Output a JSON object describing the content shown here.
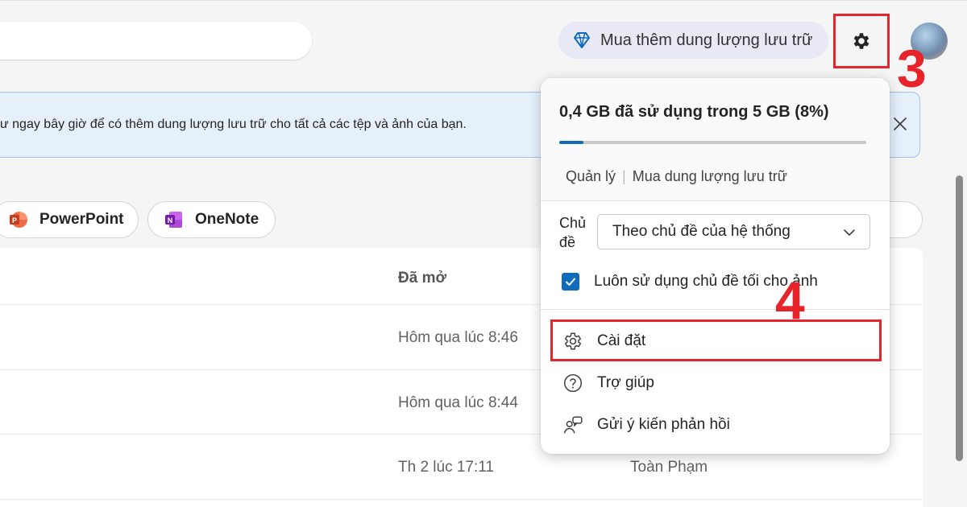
{
  "header": {
    "storage_button_label": "Mua thêm dung lượng lưu trữ"
  },
  "annotations": {
    "step_settings_gear": "3",
    "step_settings_item": "4",
    "highlight_color": "#e8242b"
  },
  "banner": {
    "text": "ư ngay bây giờ để có thêm dung lượng lưu trữ cho tất cả các tệp và ảnh của bạn."
  },
  "app_filters": [
    {
      "label": "PowerPoint",
      "icon": "powerpoint-icon",
      "color": "#c43e1c"
    },
    {
      "label": "OneNote",
      "icon": "onenote-icon",
      "color": "#7719aa"
    }
  ],
  "file_list": {
    "column_opened": "Đã mở",
    "rows": [
      {
        "opened": "Hôm qua lúc 8:46",
        "owner": ""
      },
      {
        "opened": "Hôm qua lúc 8:44",
        "owner": ""
      },
      {
        "opened": "Th 2 lúc 17:11",
        "owner": "Toàn Phạm"
      }
    ]
  },
  "settings_menu": {
    "usage_text": "0,4 GB đã sử dụng trong 5 GB (8%)",
    "usage_fraction": 0.08,
    "manage_link": "Quản lý",
    "link_separator": "|",
    "buy_storage_link": "Mua dung lượng lưu trữ",
    "theme_label": "Chủ đề",
    "theme_value": "Theo chủ đề của hệ thống",
    "dark_theme_label": "Luôn sử dụng chủ đề tối cho ảnh",
    "dark_theme_checked": true,
    "items": [
      {
        "label": "Cài đặt",
        "icon": "gear-outline-icon"
      },
      {
        "label": "Trợ giúp",
        "icon": "help-circle-icon"
      },
      {
        "label": "Gửi ý kiến phản hồi",
        "icon": "feedback-icon"
      }
    ]
  },
  "colors": {
    "accent": "#0f6cbd",
    "banner_bg": "#e5f0fb",
    "storage_pill_bg": "#e9e9f6"
  }
}
